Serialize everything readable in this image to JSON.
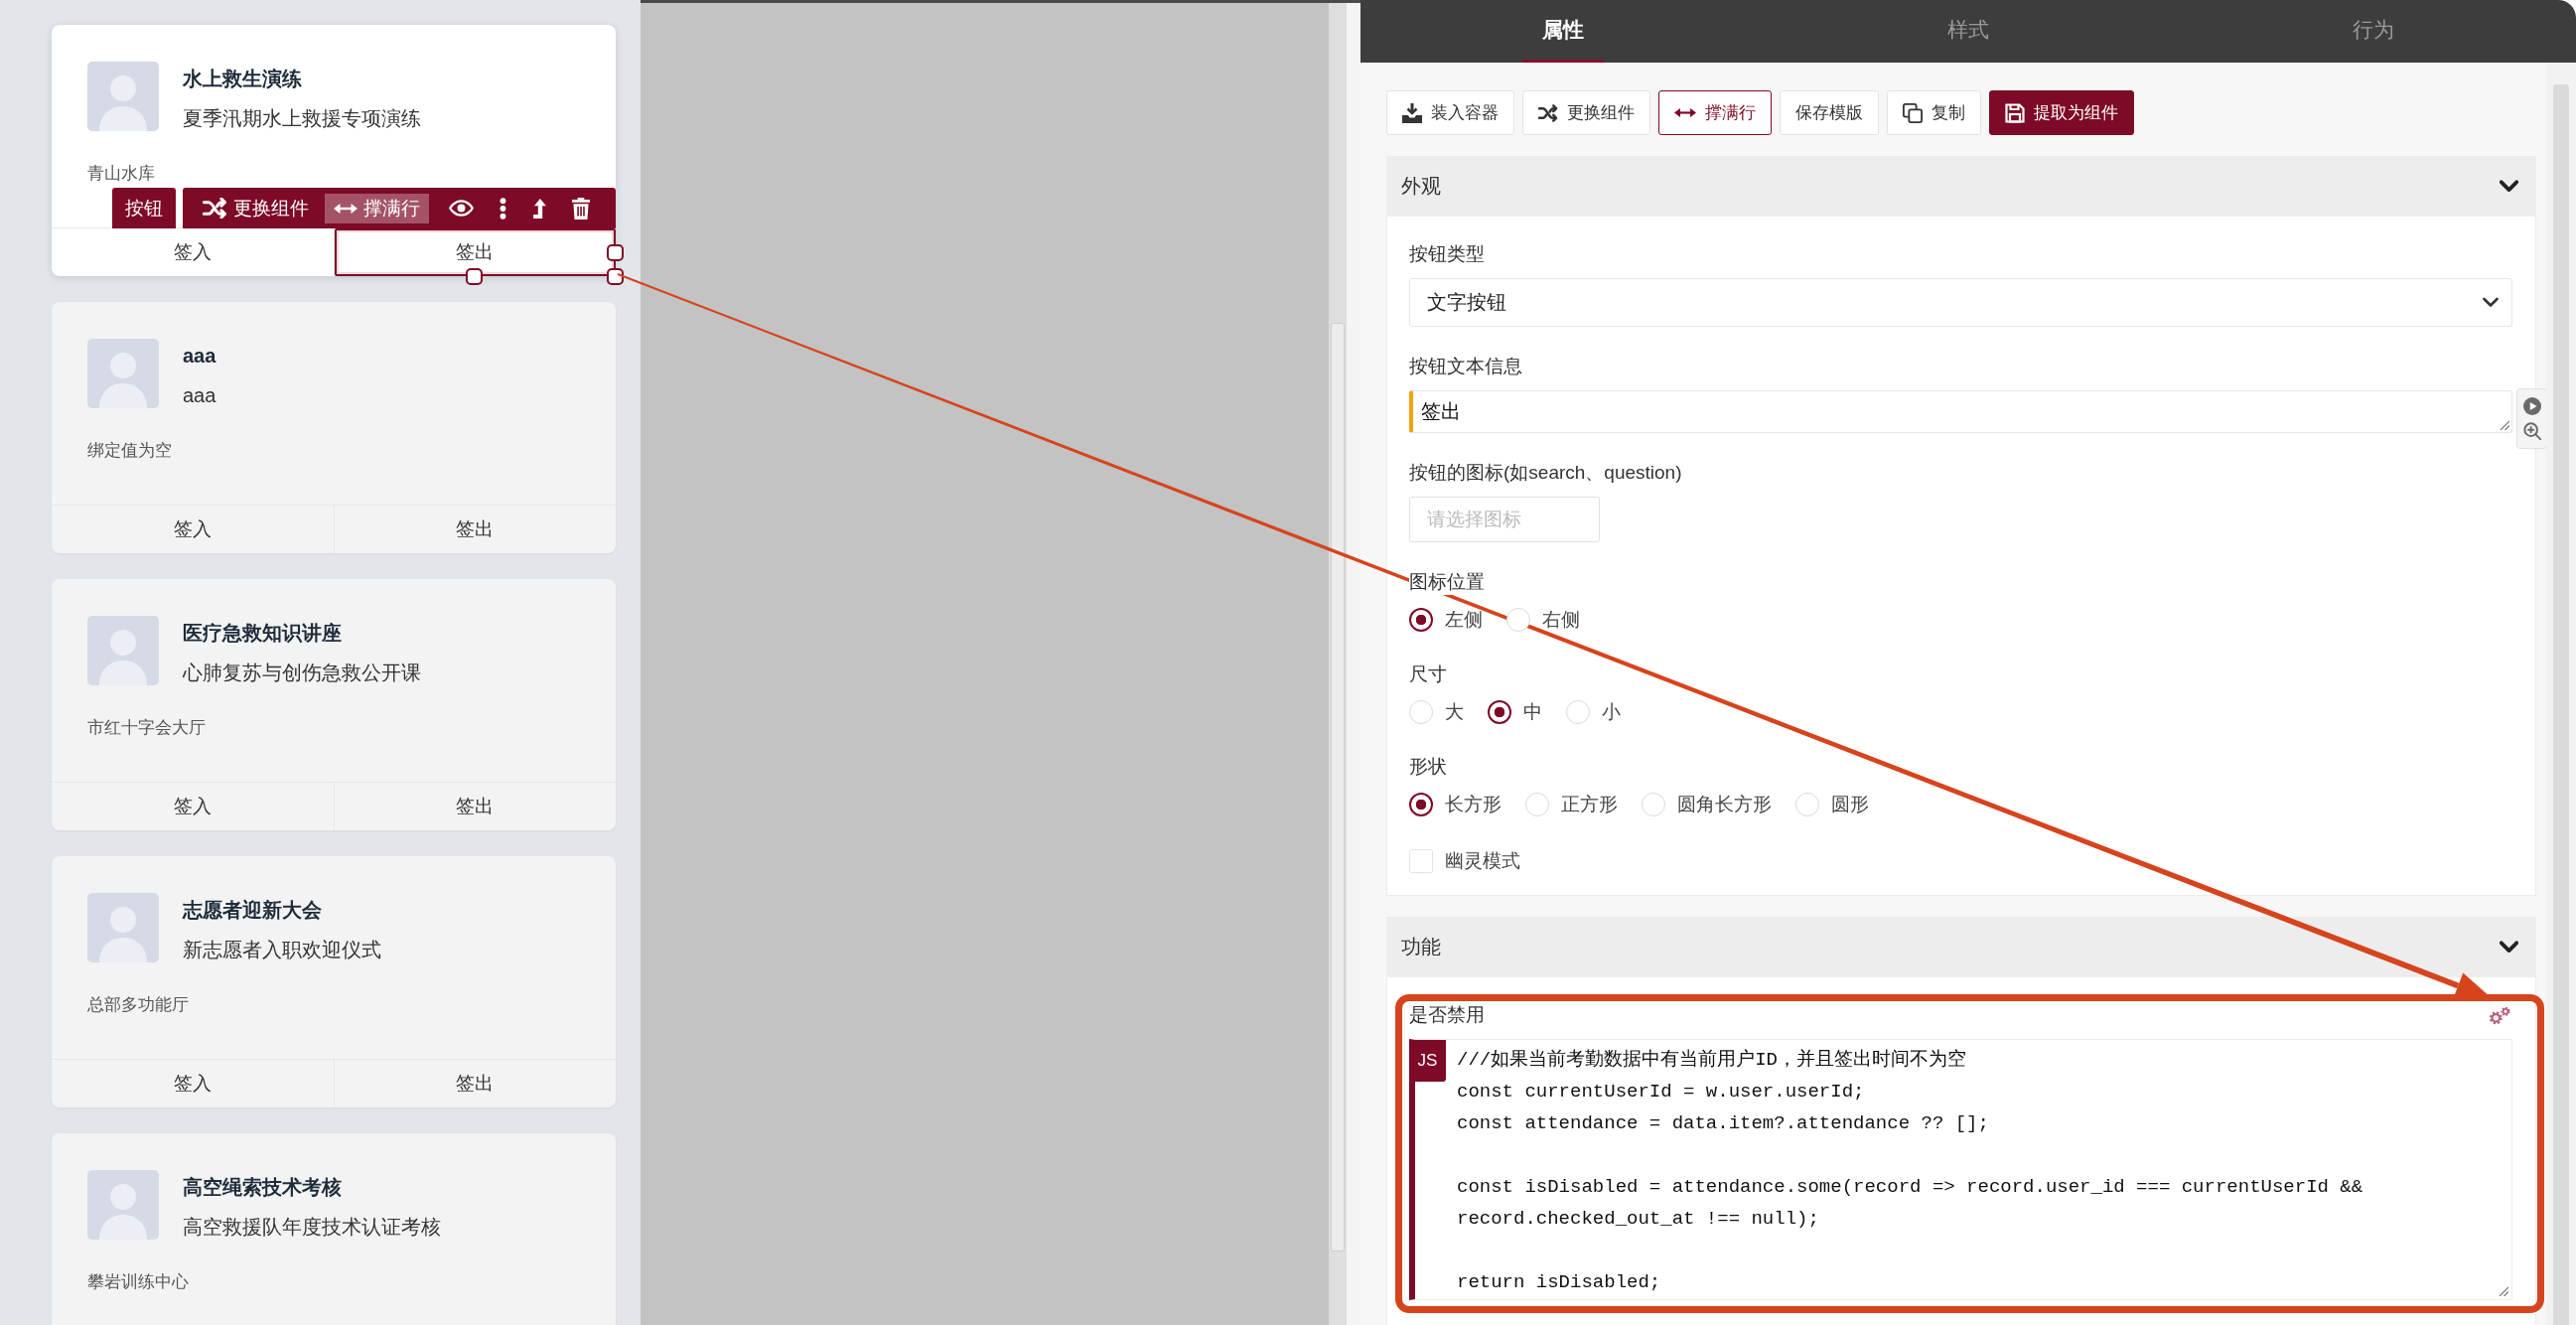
{
  "canvas": {
    "cards": [
      {
        "title": "水上救生演练",
        "subtitle": "夏季汛期水上救援专项演练",
        "location": "青山水库",
        "selected": true,
        "buttons": [
          {
            "label": "签入",
            "selected": false
          },
          {
            "label": "签出",
            "selected": true
          }
        ]
      },
      {
        "title": "aaa",
        "subtitle": "aaa",
        "location": "绑定值为空",
        "selected": false,
        "buttons": [
          {
            "label": "签入",
            "selected": false
          },
          {
            "label": "签出",
            "selected": false
          }
        ]
      },
      {
        "title": "医疗急救知识讲座",
        "subtitle": "心肺复苏与创伤急救公开课",
        "location": "市红十字会大厅",
        "selected": false,
        "buttons": [
          {
            "label": "签入",
            "selected": false
          },
          {
            "label": "签出",
            "selected": false
          }
        ]
      },
      {
        "title": "志愿者迎新大会",
        "subtitle": "新志愿者入职欢迎仪式",
        "location": "总部多功能厅",
        "selected": false,
        "buttons": [
          {
            "label": "签入",
            "selected": false
          },
          {
            "label": "签出",
            "selected": false
          }
        ]
      },
      {
        "title": "高空绳索技术考核",
        "subtitle": "高空救援队年度技术认证考核",
        "location": "攀岩训练中心",
        "selected": false
      }
    ],
    "component_toolbar": {
      "tag": "按钮",
      "actions": [
        {
          "kind": "swap",
          "label": "更换组件",
          "on": false
        },
        {
          "kind": "stretch",
          "label": "撑满行",
          "on": true
        },
        {
          "kind": "preview",
          "on": false
        },
        {
          "kind": "more",
          "on": false
        },
        {
          "kind": "up",
          "on": false
        },
        {
          "kind": "delete",
          "on": false
        }
      ]
    }
  },
  "properties_panel": {
    "tabs": [
      {
        "label": "属性",
        "selected": true
      },
      {
        "label": "样式",
        "selected": false
      },
      {
        "label": "行为",
        "selected": false
      }
    ],
    "actions": [
      {
        "kind": "container",
        "label": "装入容器",
        "on": false
      },
      {
        "kind": "swap",
        "label": "更换组件",
        "on": false
      },
      {
        "kind": "stretch",
        "label": "撑满行",
        "on": true
      },
      {
        "kind": "template",
        "label": "保存模版",
        "on": false
      },
      {
        "kind": "copy",
        "label": "复制",
        "on": false
      }
    ],
    "primary_action": {
      "label": "提取为组件"
    },
    "sections": [
      {
        "title": "外观",
        "expanded": true,
        "fields": [
          {
            "kind": "select",
            "label": "按钮类型",
            "value": "文字按钮"
          },
          {
            "kind": "textarea",
            "label": "按钮文本信息",
            "value": "签出"
          },
          {
            "kind": "input",
            "label": "按钮的图标(如search、question)",
            "placeholder": "请选择图标"
          },
          {
            "kind": "radio",
            "label": "图标位置",
            "options": [
              {
                "label": "左侧",
                "selected": true
              },
              {
                "label": "右侧",
                "selected": false
              }
            ]
          },
          {
            "kind": "radio",
            "label": "尺寸",
            "options": [
              {
                "label": "大",
                "selected": false
              },
              {
                "label": "中",
                "selected": true
              },
              {
                "label": "小",
                "selected": false
              }
            ]
          },
          {
            "kind": "radio",
            "label": "形状",
            "options": [
              {
                "label": "长方形",
                "selected": true
              },
              {
                "label": "正方形",
                "selected": false
              },
              {
                "label": "圆角长方形",
                "selected": false
              },
              {
                "label": "圆形",
                "selected": false
              }
            ]
          },
          {
            "kind": "checkbox",
            "label": "幽灵模式",
            "checked": false
          }
        ]
      },
      {
        "title": "功能",
        "expanded": true,
        "fields": [
          {
            "kind": "code",
            "label": "是否禁用",
            "language": "JS",
            "code": "///如果当前考勤数据中有当前用户ID，并且签出时间不为空\nconst currentUserId = w.user.userId;\nconst attendance = data.item?.attendance ?? [];\n\nconst isDisabled = attendance.some(record => record.user_id === currentUserId &&\nrecord.checked_out_at !== null);\n\nreturn isDisabled;"
          }
        ]
      }
    ]
  }
}
